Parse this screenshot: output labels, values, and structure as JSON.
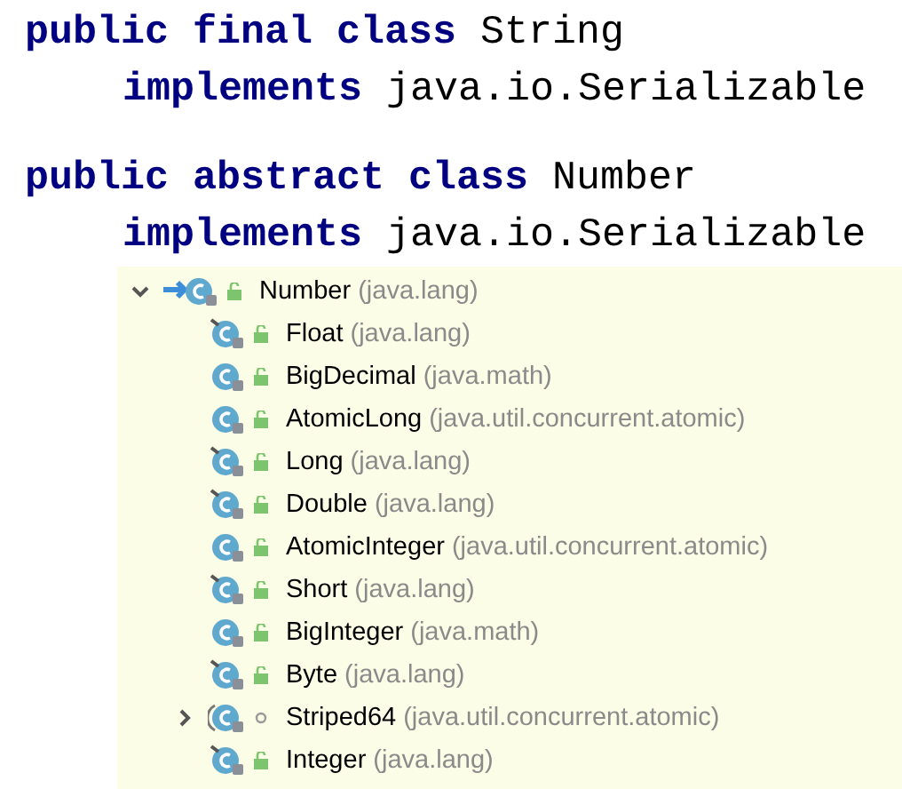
{
  "declarations": [
    {
      "segments": [
        {
          "kind": "keyword",
          "text": "public final class"
        },
        {
          "kind": "plain",
          "text": " String"
        }
      ],
      "children": [
        {
          "segments": [
            {
              "kind": "keyword",
              "text": "implements"
            },
            {
              "kind": "plain",
              "text": " java.io.Serializable"
            }
          ]
        }
      ]
    },
    {
      "segments": [
        {
          "kind": "keyword",
          "text": "public abstract class"
        },
        {
          "kind": "plain",
          "text": " Number"
        }
      ],
      "children": [
        {
          "segments": [
            {
              "kind": "keyword",
              "text": "implements"
            },
            {
              "kind": "plain",
              "text": " java.io.Serializable"
            }
          ]
        }
      ]
    }
  ],
  "hierarchy": {
    "name": "Number",
    "package": "(java.lang)",
    "expanded": true,
    "final": false,
    "public": true,
    "children": [
      {
        "name": "Float",
        "package": "(java.lang)",
        "final": true,
        "abstract": false,
        "public": true
      },
      {
        "name": "BigDecimal",
        "package": "(java.math)",
        "final": false,
        "abstract": false,
        "public": true
      },
      {
        "name": "AtomicLong",
        "package": "(java.util.concurrent.atomic)",
        "final": false,
        "abstract": false,
        "public": true
      },
      {
        "name": "Long",
        "package": "(java.lang)",
        "final": true,
        "abstract": false,
        "public": true
      },
      {
        "name": "Double",
        "package": "(java.lang)",
        "final": true,
        "abstract": false,
        "public": true
      },
      {
        "name": "AtomicInteger",
        "package": "(java.util.concurrent.atomic)",
        "final": false,
        "abstract": false,
        "public": true
      },
      {
        "name": "Short",
        "package": "(java.lang)",
        "final": true,
        "abstract": false,
        "public": true
      },
      {
        "name": "BigInteger",
        "package": "(java.math)",
        "final": false,
        "abstract": false,
        "public": true
      },
      {
        "name": "Byte",
        "package": "(java.lang)",
        "final": true,
        "abstract": false,
        "public": true
      },
      {
        "name": "Striped64",
        "package": "(java.util.concurrent.atomic)",
        "expanded": false,
        "final": false,
        "abstract": true,
        "public": false
      },
      {
        "name": "Integer",
        "package": "(java.lang)",
        "final": true,
        "abstract": false,
        "public": true
      }
    ]
  }
}
